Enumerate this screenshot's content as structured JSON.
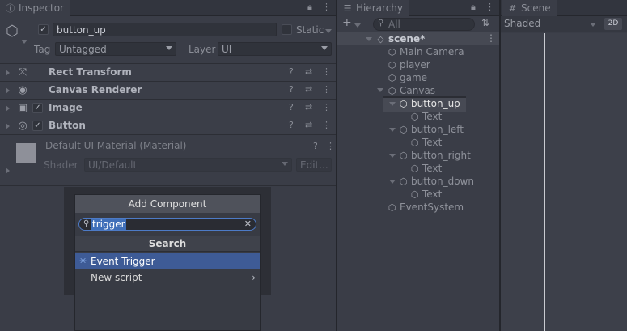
{
  "inspector": {
    "tab_title": "Inspector",
    "object_name": "button_up",
    "static_label": "Static",
    "tag_label": "Tag",
    "tag_value": "Untagged",
    "layer_label": "Layer",
    "layer_value": "UI",
    "components": [
      {
        "name": "Rect Transform",
        "icon": "rect-transform-icon"
      },
      {
        "name": "Canvas Renderer",
        "icon": "eye-icon"
      },
      {
        "name": "Image",
        "icon": "image-icon"
      },
      {
        "name": "Button",
        "icon": "button-icon"
      }
    ],
    "material": {
      "name": "Default UI Material (Material)",
      "shader_label": "Shader",
      "shader_value": "UI/Default",
      "edit_label": "Edit..."
    }
  },
  "add_component": {
    "button_label": "Add Component",
    "search_value": "trigger",
    "header": "Search",
    "results": [
      {
        "label": "Event Trigger",
        "selected": true
      },
      {
        "label": "New script",
        "selected": false
      }
    ]
  },
  "hierarchy": {
    "tab_title": "Hierarchy",
    "search_placeholder": "All",
    "scene_name": "scene*",
    "items": [
      {
        "label": "Main Camera",
        "depth": 1
      },
      {
        "label": "player",
        "depth": 1
      },
      {
        "label": "game",
        "depth": 1
      },
      {
        "label": "Canvas",
        "depth": 1
      },
      {
        "label": "button_up",
        "depth": 2
      },
      {
        "label": "Text",
        "depth": 3
      },
      {
        "label": "button_left",
        "depth": 2
      },
      {
        "label": "Text",
        "depth": 3
      },
      {
        "label": "button_right",
        "depth": 2
      },
      {
        "label": "Text",
        "depth": 3
      },
      {
        "label": "button_down",
        "depth": 2
      },
      {
        "label": "Text",
        "depth": 3
      },
      {
        "label": "EventSystem",
        "depth": 1
      }
    ]
  },
  "scene": {
    "tab_title": "Scene",
    "shading_mode": "Shaded",
    "mode_2d": "2D"
  },
  "colors": {
    "selection": "#3e5b96",
    "search_highlight": "#3f6fb9",
    "panel_bg": "#3a3d47"
  }
}
